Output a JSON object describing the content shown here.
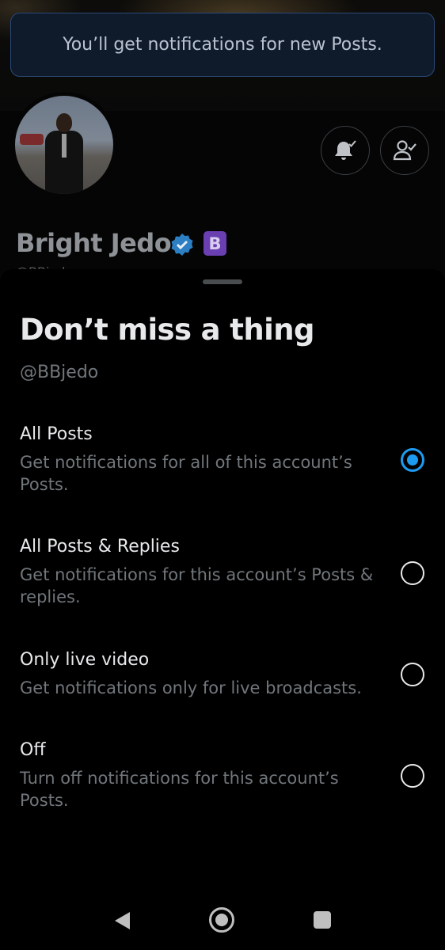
{
  "toast": {
    "text": "You’ll get notifications for new Posts."
  },
  "profile": {
    "name": "Bright Jedo",
    "badge_letter": "B",
    "handle_peek": "@BBjedo",
    "avatar_icon": "profile-photo",
    "bell_icon": "bell-check-icon",
    "follow_icon": "person-check-icon"
  },
  "sheet": {
    "title": "Don’t miss a thing",
    "handle": "@BBjedo",
    "options": [
      {
        "title": "All Posts",
        "description": "Get notifications for all of this account’s Posts.",
        "selected": true
      },
      {
        "title": "All Posts & Replies",
        "description": "Get notifications for this account’s Posts & replies.",
        "selected": false
      },
      {
        "title": "Only live video",
        "description": "Get notifications only for live broadcasts.",
        "selected": false
      },
      {
        "title": "Off",
        "description": "Turn off notifications for this account’s Posts.",
        "selected": false
      }
    ]
  },
  "navbar": {
    "back_icon": "back-triangle-icon",
    "home_icon": "home-circle-icon",
    "recents_icon": "recents-square-icon"
  },
  "colors": {
    "accent": "#1d9bf0",
    "verified": "#1d9bf0",
    "badge": "#6a3fb1",
    "toast_border": "#2b4a78"
  }
}
